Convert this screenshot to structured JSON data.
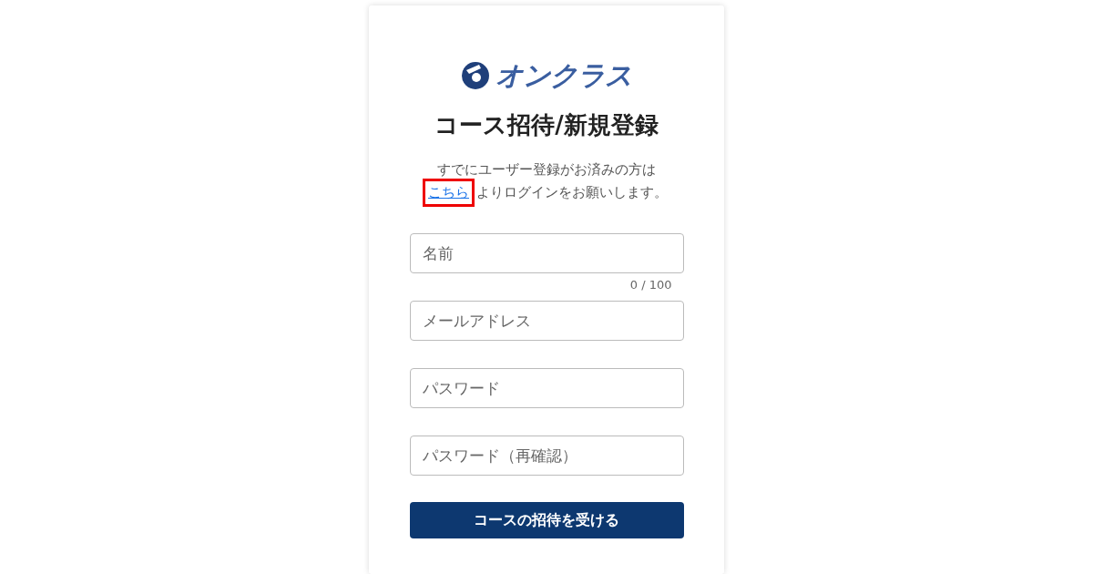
{
  "logo": {
    "text": "オンクラス"
  },
  "title": "コース招待/新規登録",
  "notice": {
    "line_1": "すでにユーザー登録がお済みの方は",
    "link": "こちら",
    "link_highlighted": true,
    "line_2_rest": "よりログインをお願いします。"
  },
  "fields": [
    {
      "placeholder": "名前",
      "counter": "0 / 100"
    },
    {
      "placeholder": "メールアドレス"
    },
    {
      "placeholder": "パスワード"
    },
    {
      "placeholder": "パスワード（再確認）"
    }
  ],
  "submit_button": "コースの招待を受ける"
}
